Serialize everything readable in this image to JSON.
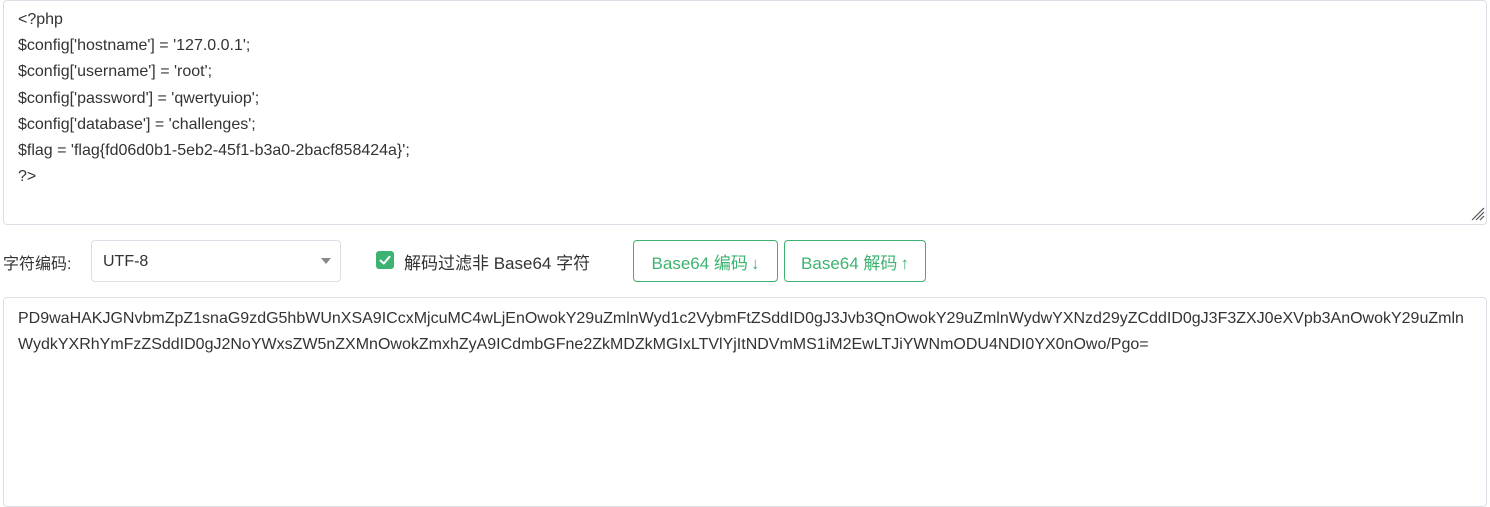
{
  "input": {
    "value": "<?php\n$config['hostname'] = '127.0.0.1';\n$config['username'] = 'root';\n$config['password'] = 'qwertyuiop';\n$config['database'] = 'challenges';\n$flag = 'flag{fd06d0b1-5eb2-45f1-b3a0-2bacf858424a}';\n?>"
  },
  "toolbar": {
    "encoding_label": "字符编码:",
    "encoding_selected": "UTF-8",
    "filter_checked": true,
    "filter_label": "解码过滤非 Base64 字符",
    "encode_label": "Base64 编码",
    "encode_arrow": "↓",
    "decode_label": "Base64 解码",
    "decode_arrow": "↑",
    "accent_color": "#3cb371"
  },
  "output": {
    "value": "PD9waHAKJGNvbmZpZ1snaG9zdG5hbWUnXSA9ICcxMjcuMC4wLjEnOwokY29uZmlnWyd1c2VybmFtZSddID0gJ3Jvb3QnOwokY29uZmlnWydwYXNzd29yZCddID0gJ3F3ZXJ0eXVpb3AnOwokY29uZmlnWydkYXRhYmFzZSddID0gJ2NoYWxsZW5nZXMnOwokZmxhZyA9ICdmbGFne2ZkMDZkMGIxLTVlYjItNDVmMS1iM2EwLTJiYWNmODU4NDI0YX0nOwo/Pgo="
  }
}
